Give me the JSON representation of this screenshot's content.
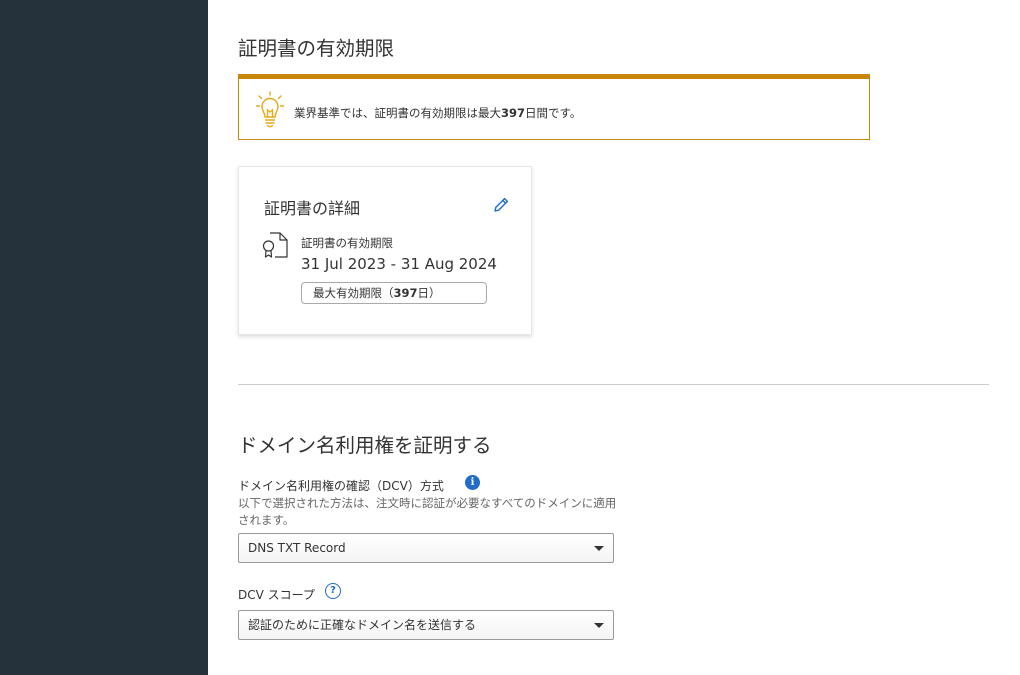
{
  "validity_section": {
    "title": "証明書の有効期限",
    "notice": {
      "text_prefix": "業界基準では、証明書の有効期限は最大",
      "text_bold": "397",
      "text_suffix": "日間です。",
      "icon": "lightbulb-icon",
      "accent_color": "#c8860b"
    },
    "card": {
      "title": "証明書の詳細",
      "edit_icon": "pencil-icon",
      "cert_icon": "certificate-icon",
      "validity_label": "証明書の有効期限",
      "validity_dates": "31 Jul 2023 - 31 Aug 2024",
      "badge_prefix": "最大有効期限（",
      "badge_bold": "397",
      "badge_suffix": "日）"
    }
  },
  "dcv_section": {
    "title": "ドメイン名利用権を証明する",
    "dcv_method": {
      "label": "ドメイン名利用権の確認（DCV）方式",
      "info_icon": "info-icon",
      "info_glyph": "i",
      "description": "以下で選択された方法は、注文時に認証が必要なすべてのドメインに適用されます。",
      "selected": "DNS TXT Record"
    },
    "dcv_scope": {
      "label": "DCV スコープ",
      "help_icon": "help-icon",
      "help_glyph": "?",
      "selected": "認証のために正確なドメイン名を送信する"
    }
  },
  "colors": {
    "sidebar": "#25313b",
    "accent_blue": "#1f6cc9",
    "notice_border": "#c8860b"
  }
}
